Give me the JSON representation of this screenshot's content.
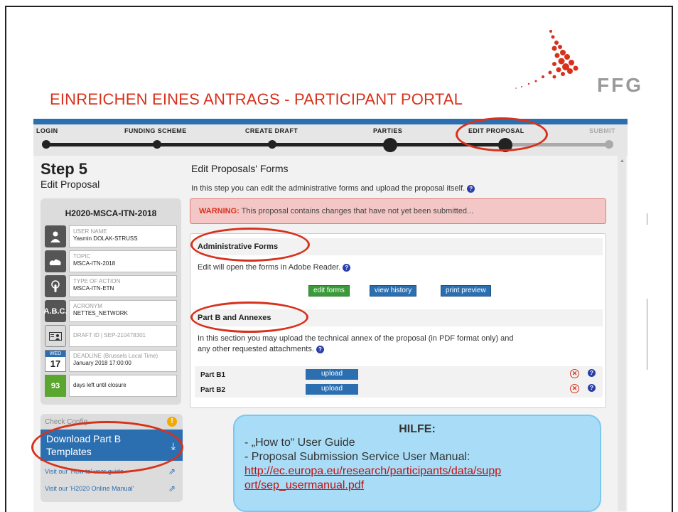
{
  "slide": {
    "title": "EINREICHEN EINES ANTRAGS - PARTICIPANT PORTAL",
    "logo_text": "FFG"
  },
  "progress": {
    "steps": [
      "LOGIN",
      "FUNDING SCHEME",
      "CREATE DRAFT",
      "PARTIES",
      "EDIT PROPOSAL",
      "SUBMIT"
    ]
  },
  "left": {
    "step_number": "Step 5",
    "step_name": "Edit Proposal",
    "call_id": "H2020-MSCA-ITN-2018",
    "user_label": "USER NAME",
    "user_value": "Yasmin DOLAK-STRUSS",
    "topic_label": "TOPIC",
    "topic_value": "MSCA-ITN-2018",
    "action_label": "TYPE OF ACTION",
    "action_value": "MSCA-ITN-ETN",
    "acronym_icon": "A.B.C.",
    "acronym_label": "ACRONYM",
    "acronym_value": "NETTES_NETWORK",
    "draft_label": "DRAFT ID | SEP-210478301",
    "cal_weekday": "WED",
    "cal_day": "17",
    "deadline_label": "DEADLINE (Brussels Local Time)",
    "deadline_value": "January 2018 17:00:00",
    "days_left": "93",
    "days_left_text": "days left until closure"
  },
  "check": {
    "label": "Check Config",
    "download_line1": "Download Part B",
    "download_line2": "Templates",
    "link1": "Visit our 'How to' user guide",
    "link2": "Visit our 'H2020 Online Manual'"
  },
  "main": {
    "heading": "Edit Proposals' Forms",
    "intro": "In this step you can edit the administrative forms and upload the proposal itself.",
    "warning_bold": "WARNING:",
    "warning_text": " This proposal contains changes that have not yet been submitted...",
    "admin_title": "Administrative Forms",
    "admin_text": "Edit will open the forms in Adobe Reader.",
    "btn_edit": "edit forms",
    "btn_history": "view history",
    "btn_print": "print preview",
    "partb_title": "Part B and Annexes",
    "partb_text1": "In this section you may upload the technical annex of the proposal (in PDF format only) and",
    "partb_text2": "any other requested attachments.",
    "rows": [
      {
        "label": "Part B1",
        "button": "upload"
      },
      {
        "label": "Part B2",
        "button": "upload"
      }
    ]
  },
  "hilfe": {
    "title": "HILFE:",
    "line1": "- „How to“ User Guide",
    "line2": "- Proposal Submission Service User Manual:",
    "url1": "http://ec.europa.eu/research/participants/data/supp",
    "url2": "ort/sep_usermanual.pdf"
  },
  "colors": {
    "accent_red": "#d8311b",
    "portal_blue": "#2b6fb1",
    "help_bg": "#a9ddf7"
  }
}
